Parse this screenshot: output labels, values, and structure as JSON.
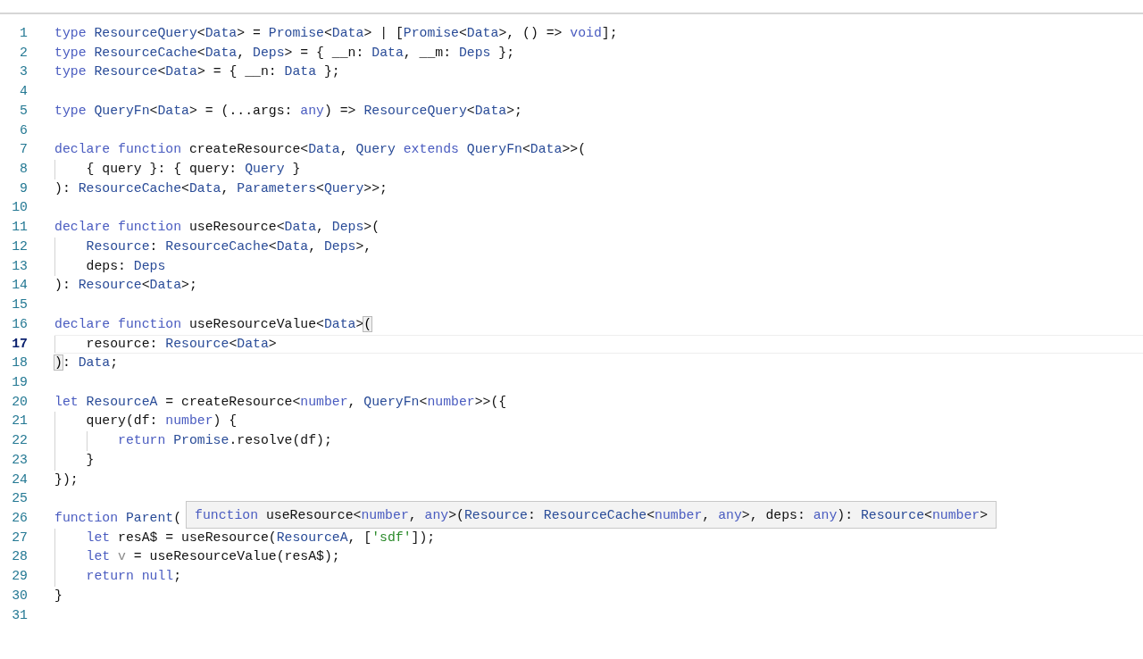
{
  "editor": {
    "lines": [
      {
        "number": "1",
        "current": false,
        "tokens": [
          {
            "text": "type ",
            "kind": "kw"
          },
          {
            "text": "ResourceQuery",
            "kind": "ty"
          },
          {
            "text": "<",
            "kind": "pl"
          },
          {
            "text": "Data",
            "kind": "ty"
          },
          {
            "text": "> = ",
            "kind": "pl"
          },
          {
            "text": "Promise",
            "kind": "ty"
          },
          {
            "text": "<",
            "kind": "pl"
          },
          {
            "text": "Data",
            "kind": "ty"
          },
          {
            "text": "> | [",
            "kind": "pl"
          },
          {
            "text": "Promise",
            "kind": "ty"
          },
          {
            "text": "<",
            "kind": "pl"
          },
          {
            "text": "Data",
            "kind": "ty"
          },
          {
            "text": ">, () => ",
            "kind": "pl"
          },
          {
            "text": "void",
            "kind": "kw"
          },
          {
            "text": "];",
            "kind": "pl"
          }
        ]
      },
      {
        "number": "2",
        "current": false,
        "tokens": [
          {
            "text": "type ",
            "kind": "kw"
          },
          {
            "text": "ResourceCache",
            "kind": "ty"
          },
          {
            "text": "<",
            "kind": "pl"
          },
          {
            "text": "Data",
            "kind": "ty"
          },
          {
            "text": ", ",
            "kind": "pl"
          },
          {
            "text": "Deps",
            "kind": "ty"
          },
          {
            "text": "> = { __n: ",
            "kind": "pl"
          },
          {
            "text": "Data",
            "kind": "ty"
          },
          {
            "text": ", __m: ",
            "kind": "pl"
          },
          {
            "text": "Deps",
            "kind": "ty"
          },
          {
            "text": " };",
            "kind": "pl"
          }
        ]
      },
      {
        "number": "3",
        "current": false,
        "tokens": [
          {
            "text": "type ",
            "kind": "kw"
          },
          {
            "text": "Resource",
            "kind": "ty"
          },
          {
            "text": "<",
            "kind": "pl"
          },
          {
            "text": "Data",
            "kind": "ty"
          },
          {
            "text": "> = { __n: ",
            "kind": "pl"
          },
          {
            "text": "Data",
            "kind": "ty"
          },
          {
            "text": " };",
            "kind": "pl"
          }
        ]
      },
      {
        "number": "4",
        "current": false
      },
      {
        "number": "5",
        "current": false,
        "tokens": [
          {
            "text": "type ",
            "kind": "kw"
          },
          {
            "text": "QueryFn",
            "kind": "ty"
          },
          {
            "text": "<",
            "kind": "pl"
          },
          {
            "text": "Data",
            "kind": "ty"
          },
          {
            "text": "> = (...args: ",
            "kind": "pl"
          },
          {
            "text": "any",
            "kind": "kw"
          },
          {
            "text": ") => ",
            "kind": "pl"
          },
          {
            "text": "ResourceQuery",
            "kind": "ty"
          },
          {
            "text": "<",
            "kind": "pl"
          },
          {
            "text": "Data",
            "kind": "ty"
          },
          {
            "text": ">;",
            "kind": "pl"
          }
        ]
      },
      {
        "number": "6",
        "current": false
      },
      {
        "number": "7",
        "current": false,
        "tokens": [
          {
            "text": "declare function ",
            "kind": "kw"
          },
          {
            "text": "createResource<",
            "kind": "pl"
          },
          {
            "text": "Data",
            "kind": "ty"
          },
          {
            "text": ", ",
            "kind": "pl"
          },
          {
            "text": "Query",
            "kind": "ty"
          },
          {
            "text": " extends ",
            "kind": "kw"
          },
          {
            "text": "QueryFn",
            "kind": "ty"
          },
          {
            "text": "<",
            "kind": "pl"
          },
          {
            "text": "Data",
            "kind": "ty"
          },
          {
            "text": ">>(",
            "kind": "pl"
          }
        ]
      },
      {
        "number": "8",
        "current": false,
        "tokens": [
          {
            "text": "    { query }: { query: ",
            "kind": "pl"
          },
          {
            "text": "Query",
            "kind": "ty"
          },
          {
            "text": " }",
            "kind": "pl"
          }
        ]
      },
      {
        "number": "9",
        "current": false,
        "tokens": [
          {
            "text": "): ",
            "kind": "pl"
          },
          {
            "text": "ResourceCache",
            "kind": "ty"
          },
          {
            "text": "<",
            "kind": "pl"
          },
          {
            "text": "Data",
            "kind": "ty"
          },
          {
            "text": ", ",
            "kind": "pl"
          },
          {
            "text": "Parameters",
            "kind": "ty"
          },
          {
            "text": "<",
            "kind": "pl"
          },
          {
            "text": "Query",
            "kind": "ty"
          },
          {
            "text": ">>;",
            "kind": "pl"
          }
        ]
      },
      {
        "number": "10",
        "current": false
      },
      {
        "number": "11",
        "current": false,
        "tokens": [
          {
            "text": "declare function ",
            "kind": "kw"
          },
          {
            "text": "useResource<",
            "kind": "pl"
          },
          {
            "text": "Data",
            "kind": "ty"
          },
          {
            "text": ", ",
            "kind": "pl"
          },
          {
            "text": "Deps",
            "kind": "ty"
          },
          {
            "text": ">(",
            "kind": "pl"
          }
        ]
      },
      {
        "number": "12",
        "current": false,
        "tokens": [
          {
            "text": "    Resource",
            "kind": "ty"
          },
          {
            "text": ": ",
            "kind": "pl"
          },
          {
            "text": "ResourceCache",
            "kind": "ty"
          },
          {
            "text": "<",
            "kind": "pl"
          },
          {
            "text": "Data",
            "kind": "ty"
          },
          {
            "text": ", ",
            "kind": "pl"
          },
          {
            "text": "Deps",
            "kind": "ty"
          },
          {
            "text": ">,",
            "kind": "pl"
          }
        ]
      },
      {
        "number": "13",
        "current": false,
        "tokens": [
          {
            "text": "    deps: ",
            "kind": "pl"
          },
          {
            "text": "Deps",
            "kind": "ty"
          }
        ]
      },
      {
        "number": "14",
        "current": false,
        "tokens": [
          {
            "text": "): ",
            "kind": "pl"
          },
          {
            "text": "Resource",
            "kind": "ty"
          },
          {
            "text": "<",
            "kind": "pl"
          },
          {
            "text": "Data",
            "kind": "ty"
          },
          {
            "text": ">;",
            "kind": "pl"
          }
        ]
      },
      {
        "number": "15",
        "current": false
      },
      {
        "number": "16",
        "current": false,
        "tokens": [
          {
            "text": "declare function ",
            "kind": "kw"
          },
          {
            "text": "useResourceValue<",
            "kind": "pl"
          },
          {
            "text": "Data",
            "kind": "ty"
          },
          {
            "text": ">",
            "kind": "pl"
          },
          {
            "text": "(",
            "kind": "bm"
          }
        ]
      },
      {
        "number": "17",
        "current": true,
        "tokens": [
          {
            "text": "    resource: ",
            "kind": "pl"
          },
          {
            "text": "Resource",
            "kind": "ty"
          },
          {
            "text": "<",
            "kind": "pl"
          },
          {
            "text": "Data",
            "kind": "ty"
          },
          {
            "text": ">",
            "kind": "pl"
          }
        ]
      },
      {
        "number": "18",
        "current": false,
        "tokens": [
          {
            "text": ")",
            "kind": "bm"
          },
          {
            "text": ": ",
            "kind": "pl"
          },
          {
            "text": "Data",
            "kind": "ty"
          },
          {
            "text": ";",
            "kind": "pl"
          }
        ]
      },
      {
        "number": "19",
        "current": false
      },
      {
        "number": "20",
        "current": false,
        "tokens": [
          {
            "text": "let ",
            "kind": "kw"
          },
          {
            "text": "ResourceA",
            "kind": "ty"
          },
          {
            "text": " = createResource<",
            "kind": "pl"
          },
          {
            "text": "number",
            "kind": "kw"
          },
          {
            "text": ", ",
            "kind": "pl"
          },
          {
            "text": "QueryFn",
            "kind": "ty"
          },
          {
            "text": "<",
            "kind": "pl"
          },
          {
            "text": "number",
            "kind": "kw"
          },
          {
            "text": ">>({",
            "kind": "pl"
          }
        ]
      },
      {
        "number": "21",
        "current": false,
        "tokens": [
          {
            "text": "    query(df: ",
            "kind": "pl"
          },
          {
            "text": "number",
            "kind": "kw"
          },
          {
            "text": ") {",
            "kind": "pl"
          }
        ]
      },
      {
        "number": "22",
        "current": false,
        "tokens": [
          {
            "text": "        return ",
            "kind": "kw"
          },
          {
            "text": "Promise",
            "kind": "ty"
          },
          {
            "text": ".resolve(df);",
            "kind": "pl"
          }
        ]
      },
      {
        "number": "23",
        "current": false,
        "tokens": [
          {
            "text": "    }",
            "kind": "pl"
          }
        ]
      },
      {
        "number": "24",
        "current": false,
        "tokens": [
          {
            "text": "});",
            "kind": "pl"
          }
        ]
      },
      {
        "number": "25",
        "current": false
      },
      {
        "number": "26",
        "current": false,
        "tokens": [
          {
            "text": "function ",
            "kind": "kw"
          },
          {
            "text": "Parent",
            "kind": "ty"
          },
          {
            "text": "(",
            "kind": "pl"
          }
        ]
      },
      {
        "number": "27",
        "current": false,
        "tokens": [
          {
            "text": "    let ",
            "kind": "kw"
          },
          {
            "text": "resA$ = useResource(",
            "kind": "pl"
          },
          {
            "text": "ResourceA",
            "kind": "ty"
          },
          {
            "text": ", [",
            "kind": "pl"
          },
          {
            "text": "'sdf'",
            "kind": "st"
          },
          {
            "text": "]);",
            "kind": "pl"
          }
        ]
      },
      {
        "number": "28",
        "current": false,
        "tokens": [
          {
            "text": "    let ",
            "kind": "kw"
          },
          {
            "text": "v",
            "kind": "un"
          },
          {
            "text": " = useResourceValue(resA$);",
            "kind": "pl"
          }
        ]
      },
      {
        "number": "29",
        "current": false,
        "tokens": [
          {
            "text": "    return null",
            "kind": "kw"
          },
          {
            "text": ";",
            "kind": "pl"
          }
        ]
      },
      {
        "number": "30",
        "current": false,
        "tokens": [
          {
            "text": "}",
            "kind": "pl"
          }
        ]
      },
      {
        "number": "31",
        "current": false
      }
    ],
    "hover_tooltip": {
      "tokens": [
        {
          "text": "function ",
          "kind": "kw"
        },
        {
          "text": "useResource<",
          "kind": "pl"
        },
        {
          "text": "number",
          "kind": "kw"
        },
        {
          "text": ", ",
          "kind": "pl"
        },
        {
          "text": "any",
          "kind": "kw"
        },
        {
          "text": ">(",
          "kind": "pl"
        },
        {
          "text": "Resource",
          "kind": "ty"
        },
        {
          "text": ": ",
          "kind": "pl"
        },
        {
          "text": "ResourceCache",
          "kind": "ty"
        },
        {
          "text": "<",
          "kind": "pl"
        },
        {
          "text": "number",
          "kind": "kw"
        },
        {
          "text": ", ",
          "kind": "pl"
        },
        {
          "text": "any",
          "kind": "kw"
        },
        {
          "text": ">, deps: ",
          "kind": "pl"
        },
        {
          "text": "any",
          "kind": "kw"
        },
        {
          "text": "): ",
          "kind": "pl"
        },
        {
          "text": "Resource",
          "kind": "ty"
        },
        {
          "text": "<",
          "kind": "pl"
        },
        {
          "text": "number",
          "kind": "kw"
        },
        {
          "text": ">",
          "kind": "pl"
        }
      ]
    }
  }
}
